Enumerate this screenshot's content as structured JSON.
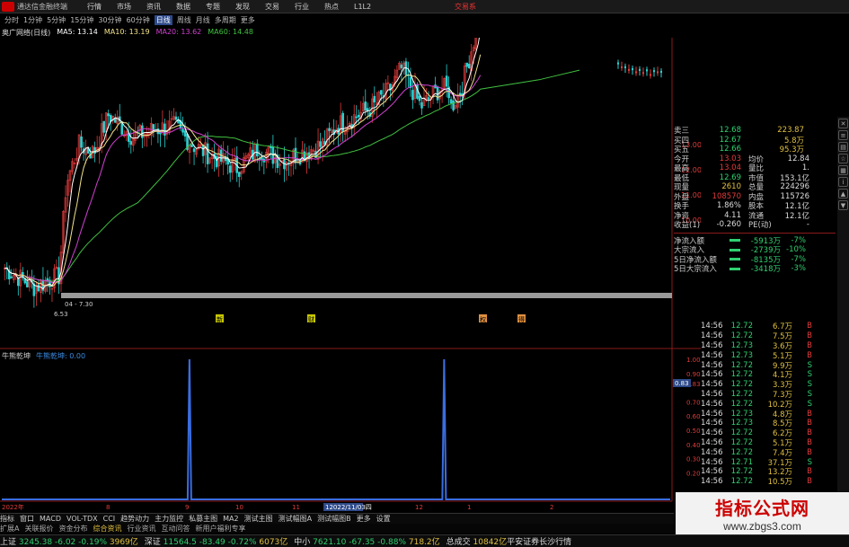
{
  "titlebar": {
    "app_name": "通达信金融终端",
    "menus": [
      "行情",
      "市场",
      "资讯",
      "数据",
      "专题",
      "发现",
      "交易",
      "行业",
      "热点",
      "L1L2"
    ],
    "trade_button": "交易系"
  },
  "period_tabs": [
    {
      "label": "分时",
      "active": false
    },
    {
      "label": "1分钟",
      "active": false
    },
    {
      "label": "5分钟",
      "active": false
    },
    {
      "label": "15分钟",
      "active": false
    },
    {
      "label": "30分钟",
      "active": false
    },
    {
      "label": "60分钟",
      "active": false
    },
    {
      "label": "日线",
      "active": true
    },
    {
      "label": "周线",
      "active": false
    },
    {
      "label": "月线",
      "active": false
    },
    {
      "label": "多周期",
      "active": false
    },
    {
      "label": "更多",
      "active": false
    }
  ],
  "main_indicator": {
    "stock": "奥广网络(日线)",
    "ma": [
      {
        "label": "MA5: 13.14",
        "color": "#ffffff"
      },
      {
        "label": "MA10: 13.19",
        "color": "#f2e28a"
      },
      {
        "label": "MA20: 13.62",
        "color": "#d040d0"
      },
      {
        "label": "MA60: 14.48",
        "color": "#40c040"
      }
    ]
  },
  "chart_data": {
    "type": "candlestick",
    "price_axis": {
      "min": 7,
      "max": 13.5,
      "ticks": [
        "13.00",
        "12.00",
        "11.00",
        "10.00"
      ]
    },
    "annotations": {
      "low_label": "6.53",
      "date_label": "04 - 7.30",
      "markers": [
        "新",
        "财",
        "权",
        "得"
      ]
    },
    "sub_indicator": {
      "name": "牛熊乾坤",
      "value_label": "牛熊乾坤: 0.00",
      "ylim": [
        0,
        1
      ],
      "ticks": [
        "1.00",
        "0.90",
        "0.83",
        "0.70",
        "0.60",
        "0.50",
        "0.40",
        "0.30",
        "0.20"
      ],
      "current_value": "0.83",
      "spike_positions": [
        0.28,
        0.66
      ]
    },
    "time_axis": [
      "2022年",
      "8",
      "9",
      "10",
      "11",
      "12022/11/03四",
      "12",
      "1",
      "2"
    ],
    "colors": {
      "up": "#e23a3a",
      "down": "#2ad1d1",
      "ma5": "#ffffff",
      "ma10": "#f2e28a",
      "ma20": "#d040d0",
      "ma60": "#40c040",
      "sub": "#3a6de0"
    }
  },
  "bottom_tabs": [
    "指标",
    "窗口",
    "MACD",
    "VOL-TDX",
    "CCI",
    "趋势动力",
    "主力监控",
    "私募主图",
    "MA2",
    "测试主图",
    "测试幅图A",
    "测试幅图B",
    "更多",
    "设置"
  ],
  "bottom_links": [
    "扩展A",
    "关联报价",
    "资金分布",
    "综合资讯",
    "行业资讯",
    "互动问答",
    "新用户福利专享"
  ],
  "quote_panel": {
    "ask_bid": [
      {
        "label": "卖三",
        "price": "12.68",
        "vol": "223.87"
      },
      {
        "label": "买四",
        "price": "12.67",
        "vol": "5.8万"
      },
      {
        "label": "买五",
        "price": "12.66",
        "vol": "95.3万"
      }
    ],
    "stats": [
      {
        "l": "今开",
        "v": "13.03",
        "l2": "均价",
        "v2": "12.84"
      },
      {
        "l": "最高",
        "v": "13.04",
        "l2": "量比",
        "v2": "1."
      },
      {
        "l": "最低",
        "v": "12.69",
        "l2": "市值",
        "v2": "153.1亿"
      },
      {
        "l": "现量",
        "v": "2610",
        "l2": "总量",
        "v2": "224296"
      },
      {
        "l": "外盘",
        "v": "108570",
        "l2": "内盘",
        "v2": "115726"
      },
      {
        "l": "换手",
        "v": "1.86%",
        "l2": "股本",
        "v2": "12.1亿"
      },
      {
        "l": "净资",
        "v": "4.11",
        "l2": "流通",
        "v2": "12.1亿"
      },
      {
        "l": "收益(1)",
        "v": "-0.260",
        "l2": "PE(动)",
        "v2": "-"
      }
    ],
    "flows": [
      {
        "l": "净流入额",
        "v": "-5913万",
        "p": "-7%"
      },
      {
        "l": "大宗流入",
        "v": "-2739万",
        "p": "-10%"
      },
      {
        "l": "5日净流入额",
        "v": "-8135万",
        "p": "-7%"
      },
      {
        "l": "5日大宗流入",
        "v": "-3418万",
        "p": "-3%"
      }
    ],
    "ticks": [
      {
        "t": "14:56",
        "p": "12.72",
        "vol": "6.7万",
        "bs": "B"
      },
      {
        "t": "14:56",
        "p": "12.72",
        "vol": "7.5万",
        "bs": "B"
      },
      {
        "t": "14:56",
        "p": "12.73",
        "vol": "3.6万",
        "bs": "B"
      },
      {
        "t": "14:56",
        "p": "12.73",
        "vol": "5.1万",
        "bs": "B"
      },
      {
        "t": "14:56",
        "p": "12.72",
        "vol": "9.9万",
        "bs": "S"
      },
      {
        "t": "14:56",
        "p": "12.72",
        "vol": "4.1万",
        "bs": "S"
      },
      {
        "t": "14:56",
        "p": "12.72",
        "vol": "3.3万",
        "bs": "S"
      },
      {
        "t": "14:56",
        "p": "12.72",
        "vol": "7.3万",
        "bs": "S"
      },
      {
        "t": "14:56",
        "p": "12.72",
        "vol": "10.2万",
        "bs": "S"
      },
      {
        "t": "14:56",
        "p": "12.73",
        "vol": "4.8万",
        "bs": "B"
      },
      {
        "t": "14:56",
        "p": "12.73",
        "vol": "8.5万",
        "bs": "B"
      },
      {
        "t": "14:56",
        "p": "12.72",
        "vol": "6.2万",
        "bs": "B"
      },
      {
        "t": "14:56",
        "p": "12.72",
        "vol": "5.1万",
        "bs": "B"
      },
      {
        "t": "14:56",
        "p": "12.72",
        "vol": "7.4万",
        "bs": "B"
      },
      {
        "t": "14:56",
        "p": "12.71",
        "vol": "37.1万",
        "bs": "S"
      },
      {
        "t": "14:56",
        "p": "12.72",
        "vol": "13.2万",
        "bs": "B"
      },
      {
        "t": "14:56",
        "p": "12.72",
        "vol": "10.5万",
        "bs": "B"
      }
    ]
  },
  "statusbar": [
    {
      "label": "上证",
      "value": "3245.38",
      "chg": "-6.02",
      "pct": "-0.19%",
      "amt": "3969亿"
    },
    {
      "label": "深证",
      "value": "11564.5",
      "chg": "-83.49",
      "pct": "-0.72%",
      "amt": "6073亿"
    },
    {
      "label": "中小",
      "value": "7621.10",
      "chg": "-67.35",
      "pct": "-0.88%",
      "amt": "718.2亿"
    }
  ],
  "statusbar_extra": {
    "label": "总成交",
    "value": "10842亿",
    "note": "平安证券长沙行情"
  },
  "watermark": {
    "line1": "指标公式网",
    "line2": "www.zbgs3.com"
  }
}
